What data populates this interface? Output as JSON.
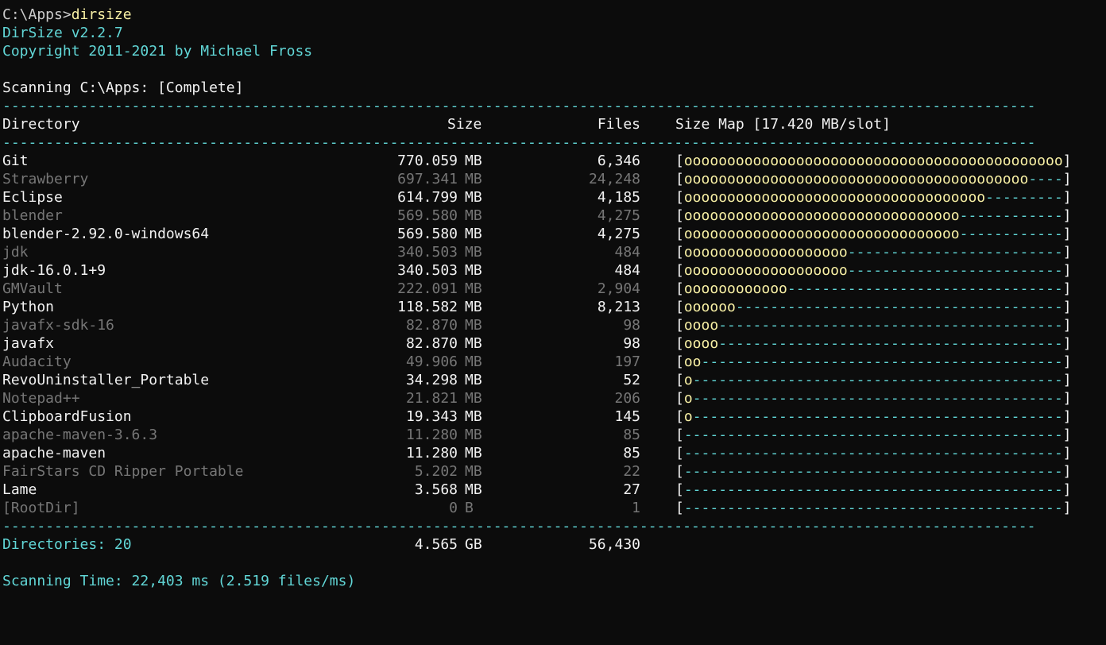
{
  "prompt": {
    "path": "C:\\Apps>",
    "command": "dirsize"
  },
  "banner": {
    "version": "DirSize v2.2.7",
    "copyright": "Copyright 2011-2021 by Michael Fross"
  },
  "status": {
    "scanning": "Scanning C:\\Apps: [Complete]"
  },
  "separator": "------------------------------------------------------------------------------------------------------------------------",
  "header": {
    "directory": "Directory",
    "size": "Size",
    "files": "Files",
    "size_map": "Size Map [17.420 MB/slot]"
  },
  "rows": [
    {
      "name": "Git",
      "size": "770.059",
      "unit": "MB",
      "files": "6,346",
      "map_fill": "oooooooooooooooooooooooooooooooooooooooooooo",
      "map_empty": "",
      "style": "bright"
    },
    {
      "name": "Strawberry",
      "size": "697.341",
      "unit": "MB",
      "files": "24,248",
      "map_fill": "oooooooooooooooooooooooooooooooooooooooo",
      "map_empty": "----",
      "style": "dim"
    },
    {
      "name": "Eclipse",
      "size": "614.799",
      "unit": "MB",
      "files": "4,185",
      "map_fill": "ooooooooooooooooooooooooooooooooooo",
      "map_empty": "---------",
      "style": "bright"
    },
    {
      "name": "blender",
      "size": "569.580",
      "unit": "MB",
      "files": "4,275",
      "map_fill": "oooooooooooooooooooooooooooooooo",
      "map_empty": "------------",
      "style": "dim"
    },
    {
      "name": "blender-2.92.0-windows64",
      "size": "569.580",
      "unit": "MB",
      "files": "4,275",
      "map_fill": "oooooooooooooooooooooooooooooooo",
      "map_empty": "------------",
      "style": "bright"
    },
    {
      "name": "jdk",
      "size": "340.503",
      "unit": "MB",
      "files": "484",
      "map_fill": "ooooooooooooooooooo",
      "map_empty": "-------------------------",
      "style": "dim"
    },
    {
      "name": "jdk-16.0.1+9",
      "size": "340.503",
      "unit": "MB",
      "files": "484",
      "map_fill": "ooooooooooooooooooo",
      "map_empty": "-------------------------",
      "style": "bright"
    },
    {
      "name": "GMVault",
      "size": "222.091",
      "unit": "MB",
      "files": "2,904",
      "map_fill": "oooooooooooo",
      "map_empty": "--------------------------------",
      "style": "dim"
    },
    {
      "name": "Python",
      "size": "118.582",
      "unit": "MB",
      "files": "8,213",
      "map_fill": "oooooo",
      "map_empty": "--------------------------------------",
      "style": "bright"
    },
    {
      "name": "javafx-sdk-16",
      "size": "82.870",
      "unit": "MB",
      "files": "98",
      "map_fill": "oooo",
      "map_empty": "----------------------------------------",
      "style": "dim"
    },
    {
      "name": "javafx",
      "size": "82.870",
      "unit": "MB",
      "files": "98",
      "map_fill": "oooo",
      "map_empty": "----------------------------------------",
      "style": "bright"
    },
    {
      "name": "Audacity",
      "size": "49.906",
      "unit": "MB",
      "files": "197",
      "map_fill": "oo",
      "map_empty": "------------------------------------------",
      "style": "dim"
    },
    {
      "name": "RevoUninstaller_Portable",
      "size": "34.298",
      "unit": "MB",
      "files": "52",
      "map_fill": "o",
      "map_empty": "-------------------------------------------",
      "style": "bright"
    },
    {
      "name": "Notepad++",
      "size": "21.821",
      "unit": "MB",
      "files": "206",
      "map_fill": "o",
      "map_empty": "-------------------------------------------",
      "style": "dim"
    },
    {
      "name": "ClipboardFusion",
      "size": "19.343",
      "unit": "MB",
      "files": "145",
      "map_fill": "o",
      "map_empty": "-------------------------------------------",
      "style": "bright"
    },
    {
      "name": "apache-maven-3.6.3",
      "size": "11.280",
      "unit": "MB",
      "files": "85",
      "map_fill": "",
      "map_empty": "--------------------------------------------",
      "style": "dim"
    },
    {
      "name": "apache-maven",
      "size": "11.280",
      "unit": "MB",
      "files": "85",
      "map_fill": "",
      "map_empty": "--------------------------------------------",
      "style": "bright"
    },
    {
      "name": "FairStars CD Ripper Portable",
      "size": "5.202",
      "unit": "MB",
      "files": "22",
      "map_fill": "",
      "map_empty": "--------------------------------------------",
      "style": "dim"
    },
    {
      "name": "Lame",
      "size": "3.568",
      "unit": "MB",
      "files": "27",
      "map_fill": "",
      "map_empty": "--------------------------------------------",
      "style": "bright"
    },
    {
      "name": "[RootDir]",
      "size": "0",
      "unit": "B",
      "files": "1",
      "map_fill": "",
      "map_empty": "--------------------------------------------",
      "style": "dim"
    }
  ],
  "summary": {
    "directories": "Directories: 20",
    "size": "4.565",
    "unit": "GB",
    "files": "56,430"
  },
  "timing": {
    "text": "Scanning Time: 22,403 ms (2.519 files/ms)"
  },
  "colors": {
    "background": "#0c0c0c",
    "cyan": "#61d6d6",
    "yellow": "#f9f1a5",
    "bright": "#f2f2f2",
    "dim": "#767676"
  }
}
